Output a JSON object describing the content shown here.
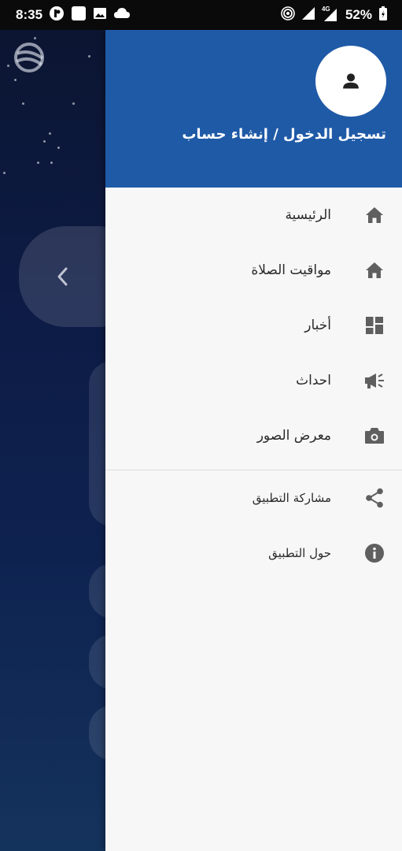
{
  "status_bar": {
    "time": "8:35",
    "network": "4G",
    "battery": "52%",
    "icons": [
      "notification-circle-icon",
      "app-square-icon",
      "image-icon",
      "cloud-icon",
      "hotspot-icon",
      "signal-icon",
      "signal-4g-icon",
      "battery-icon"
    ]
  },
  "drawer": {
    "header": {
      "avatar_icon": "person-icon",
      "login_text": "تسجيل الدخول / إنشاء حساب",
      "background_color": "#1f5aa7"
    },
    "primary_items": [
      {
        "label": "الرئيسية",
        "icon": "home-icon"
      },
      {
        "label": "مواقيت الصلاة",
        "icon": "home-icon"
      },
      {
        "label": "أخبار",
        "icon": "dashboard-icon"
      },
      {
        "label": "احداث",
        "icon": "megaphone-icon"
      },
      {
        "label": "معرض الصور",
        "icon": "camera-icon"
      }
    ],
    "secondary_items": [
      {
        "label": "مشاركة التطبيق",
        "icon": "share-icon"
      },
      {
        "label": "حول التطبيق",
        "icon": "info-icon"
      }
    ]
  }
}
